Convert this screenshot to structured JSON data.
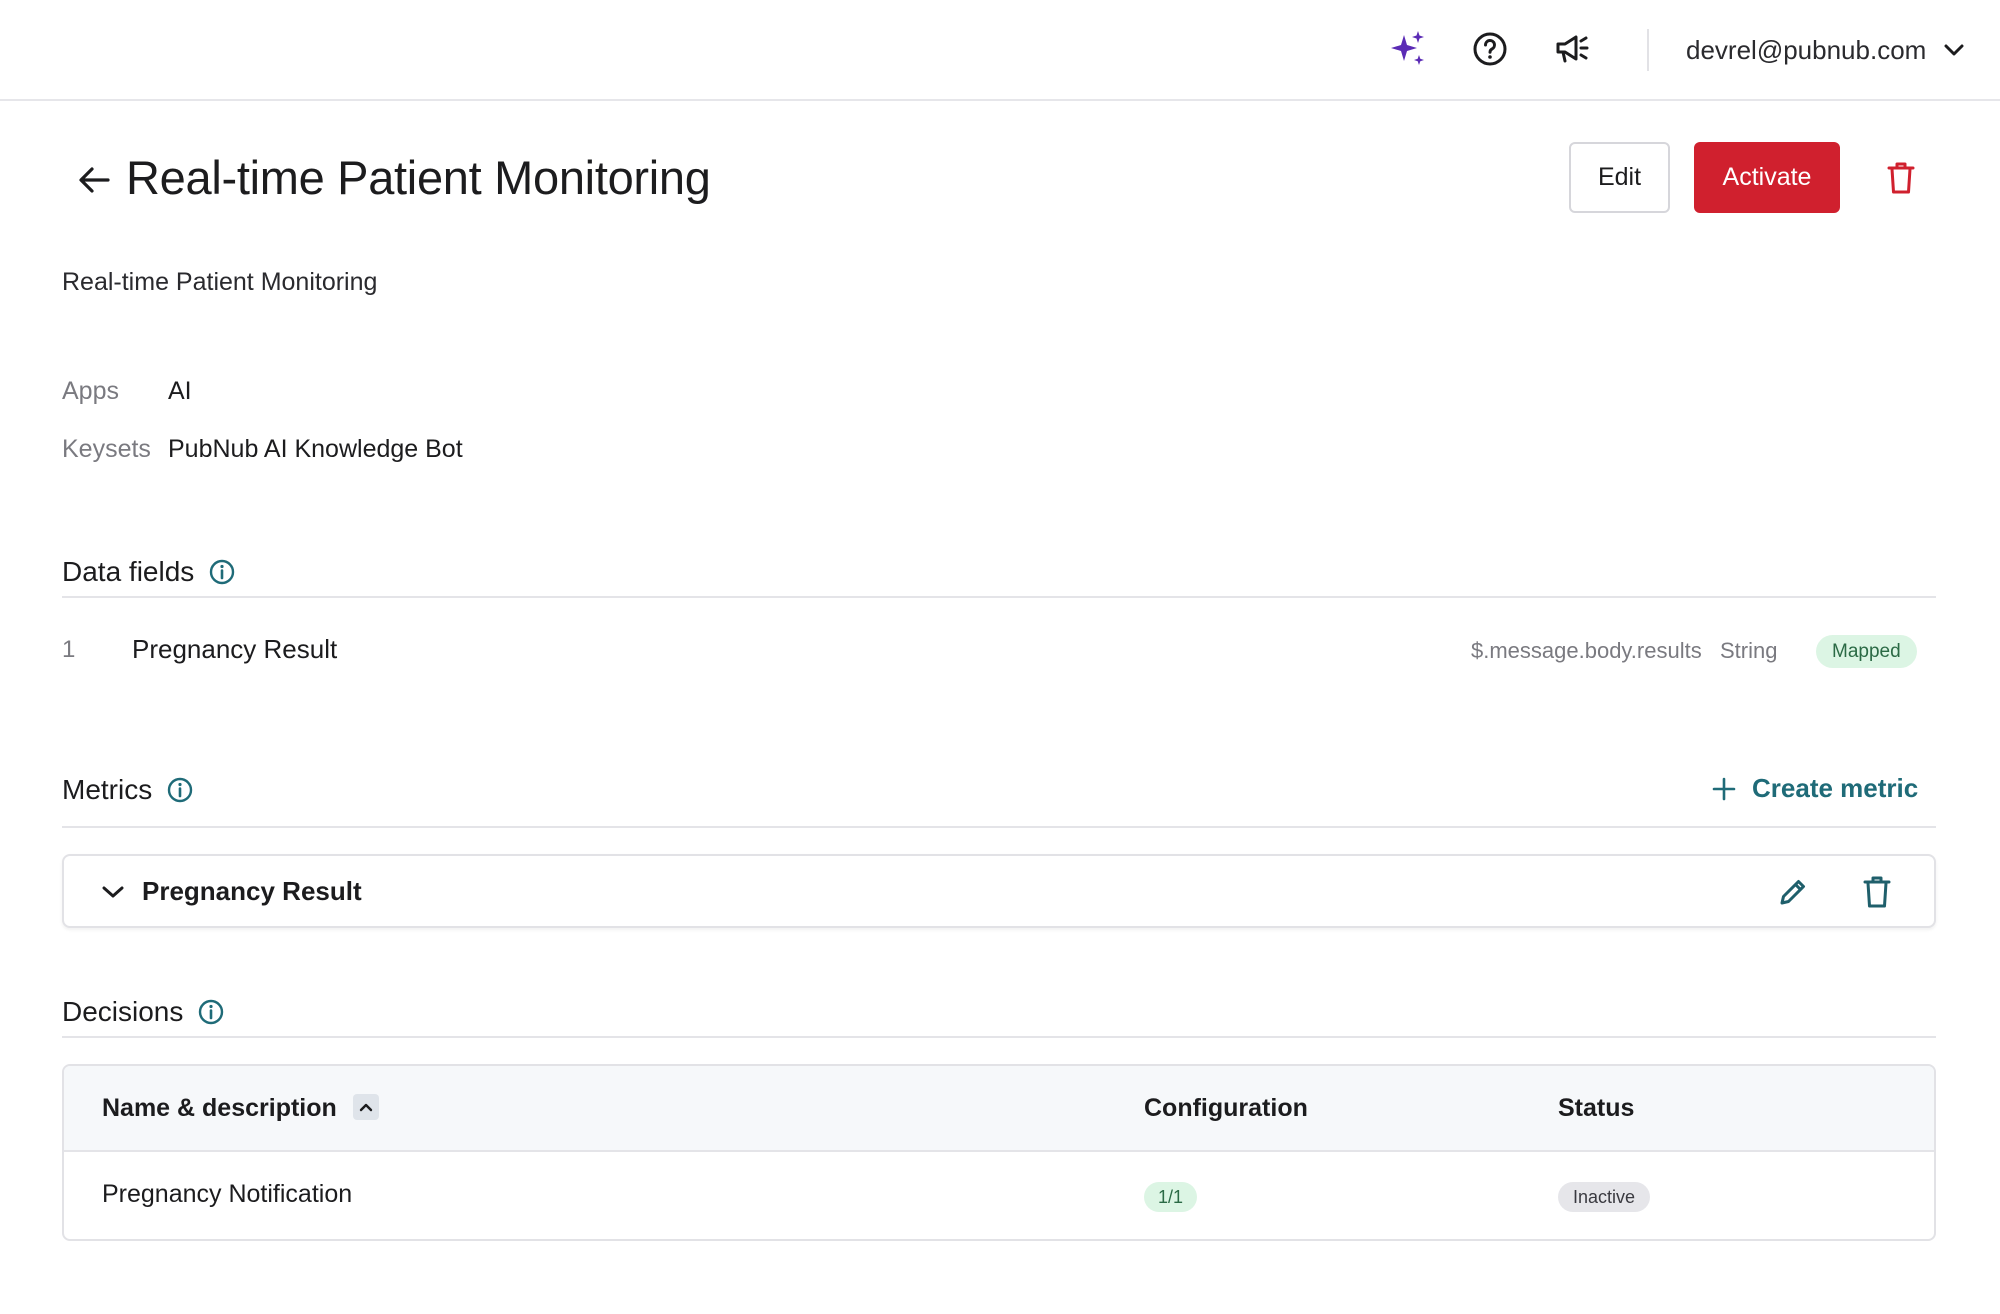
{
  "topbar": {
    "icons": [
      "sparkle-icon",
      "help-icon",
      "megaphone-icon"
    ],
    "account_email": "devrel@pubnub.com"
  },
  "header": {
    "title": "Real-time Patient Monitoring",
    "edit_label": "Edit",
    "activate_label": "Activate"
  },
  "description": "Real-time Patient Monitoring",
  "meta": {
    "apps_label": "Apps",
    "apps_value": "AI",
    "keysets_label": "Keysets",
    "keysets_value": "PubNub AI Knowledge Bot"
  },
  "data_fields": {
    "title": "Data fields",
    "rows": [
      {
        "index": "1",
        "name": "Pregnancy Result",
        "path": "$.message.body.results",
        "type": "String",
        "status": "Mapped"
      }
    ]
  },
  "metrics": {
    "title": "Metrics",
    "create_label": "Create metric",
    "items": [
      {
        "name": "Pregnancy Result"
      }
    ]
  },
  "decisions": {
    "title": "Decisions",
    "columns": [
      "Name & description",
      "Configuration",
      "Status"
    ],
    "rows": [
      {
        "name": "Pregnancy Notification",
        "configuration": "1/1",
        "status": "Inactive"
      }
    ]
  },
  "colors": {
    "accent_red": "#d0202e",
    "link_teal": "#1f6b78",
    "sparkle_purple": "#5b2bb5",
    "badge_green_bg": "#dcf5e4"
  }
}
